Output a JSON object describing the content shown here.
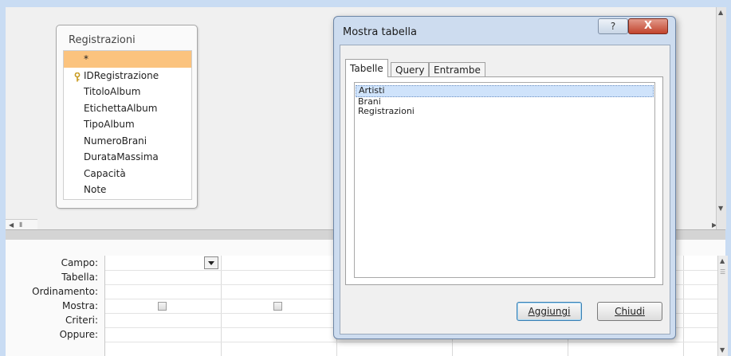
{
  "table_box": {
    "title": "Registrazioni",
    "fields": [
      {
        "name": "*",
        "key": false,
        "highlighted": true
      },
      {
        "name": "IDRegistrazione",
        "key": true,
        "highlighted": false
      },
      {
        "name": "TitoloAlbum",
        "key": false,
        "highlighted": false
      },
      {
        "name": "EtichettaAlbum",
        "key": false,
        "highlighted": false
      },
      {
        "name": "TipoAlbum",
        "key": false,
        "highlighted": false
      },
      {
        "name": "NumeroBrani",
        "key": false,
        "highlighted": false
      },
      {
        "name": "DurataMassima",
        "key": false,
        "highlighted": false
      },
      {
        "name": "Capacità",
        "key": false,
        "highlighted": false
      },
      {
        "name": "Note",
        "key": false,
        "highlighted": false
      }
    ]
  },
  "query_grid": {
    "row_labels": [
      "Campo:",
      "Tabella:",
      "Ordinamento:",
      "Mostra:",
      "Criteri:",
      "Oppure:"
    ]
  },
  "dialog": {
    "title": "Mostra tabella",
    "help_glyph": "?",
    "close_glyph": "X",
    "tabs": [
      "Tabelle",
      "Query",
      "Entrambe"
    ],
    "active_tab": "Tabelle",
    "items": [
      "Artisti",
      "Brani",
      "Registrazioni"
    ],
    "selected_item": "Artisti",
    "add_button": "Aggiungi",
    "close_button": "Chiudi"
  },
  "colors": {
    "background": "#c9dcf3",
    "field_highlight": "#fbc37e",
    "selection": "#cfe3fb",
    "close_button": "#c1442d"
  }
}
